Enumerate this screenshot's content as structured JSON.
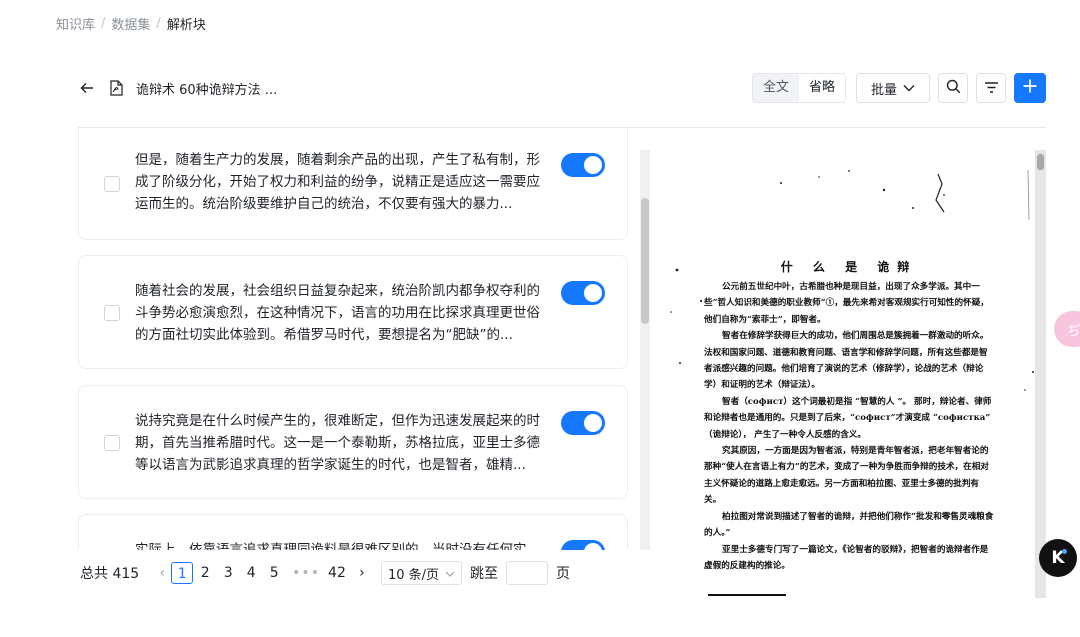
{
  "breadcrumb": {
    "items": [
      "知识库",
      "数据集",
      "解析块"
    ],
    "sep": "/"
  },
  "doc": {
    "title": "诡辩术 60种诡辩方法 ..."
  },
  "toolbar": {
    "view_full": "全文",
    "view_brief": "省略",
    "batch_label": "批量",
    "search_icon": "search-icon",
    "filter_icon": "filter-icon",
    "add_icon": "plus-icon",
    "accent": "#1677ff"
  },
  "chunks": [
    {
      "text": "但是，随着生产力的发展，随着剩余产品的出现，产生了私有制，形成了阶级分化，开始了权力和利益的纷争，说精正是适应这一需要应运而生的。统治阶级要维护自己的统治，不仅要有强大的暴力...",
      "enabled": true,
      "checked": false
    },
    {
      "text": "随着社会的发展，社会组织日益复杂起来，统治阶凯内都争权夺利的斗争势必愈演愈烈，在这种情况下，语言的功用在比探求真理更世俗的方面社切实此体验到。希借罗马时代，要想提名为“肥缺”的...",
      "enabled": true,
      "checked": false
    },
    {
      "text": "说持究竟是在什么时候产生的，很难断定，但作为迅速发展起来的时期，首先当推希腊时代。这一是一个泰勒斯，苏格拉底，亚里士多德等以语言为武影追求真理的哲学家诞生的时代，也是智者，雄精...",
      "enabled": true,
      "checked": false
    },
    {
      "text": "实际上，依靠语言追求真理同诡料是很难区别的，当时没有任何实",
      "enabled": true,
      "checked": false
    }
  ],
  "pagination": {
    "total_label": "总共 415",
    "pages": [
      "1",
      "2",
      "3",
      "4",
      "5"
    ],
    "current": "1",
    "ellipsis": "•••",
    "last": "42",
    "page_size": "10 条/页",
    "goto_label": "跳至",
    "page_unit": "页"
  },
  "preview": {
    "title": "什 么 是 诡辩",
    "paragraphs": [
      "公元前五世纪中叶，古希腊也种是现目益，出现了众多学派。其中一些“哲人知识和美德的职业教师”①，最先来希对客观规实行可知性的怀疑，他们自称为“索菲士”，即智者。",
      "智者在修辞学获得巨大的成功，他们周围总是簇拥着一群激动的听众。法权和国家问题、道德和教育问题、语言学和修辞学问题，所有这些都是智者派感兴趣的问题。他们培育了演说的艺术（修辞学），论战的艺术（辩论学）和证明的艺术（辩证法）。",
      "智者（софист）这个词最初是指 “智慧的人 ”。 那时，辩论者、律师和论辩者也是通用的。只是到了后来，“софист”才演变成 “софистка” （诡辩论）， 产生了一种令人反感的含义。",
      "究其原因，一方面是因为智者派，特别是青年智者派，把老年智者论的那种“使人在言语上有力”的艺术，变成了一种为争胜而争辩的技术，在相对主义怀疑论的道路上愈走愈远。另一方面和柏拉图、亚里士多德的批判有关。",
      "柏拉图对常说到描述了智者的诡辩，并把他们称作“批发和零售灵魂粮食的人。”",
      "亚里士多德专门写了一篇论文，《论智者的驳辩》，把智者的诡辩者作是虚假的反建构的推论。"
    ]
  },
  "floating": {
    "side_text": "ぢ",
    "badge_letter": "K"
  }
}
